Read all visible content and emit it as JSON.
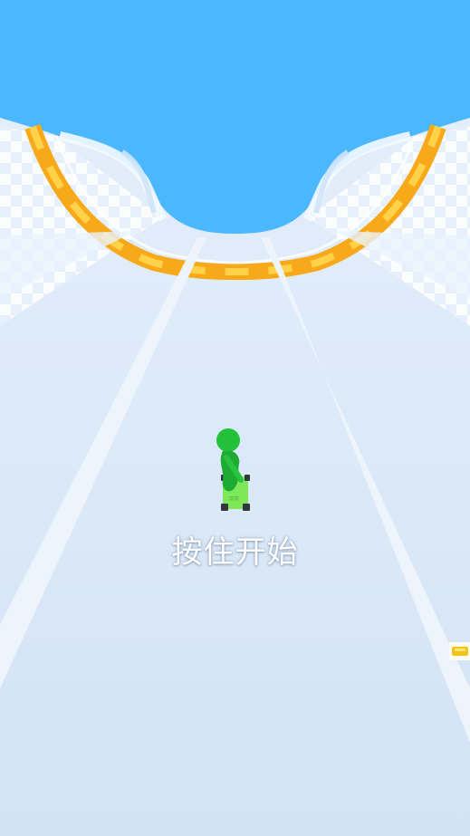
{
  "game": {
    "start_hint": "按住开始"
  },
  "player": {
    "character_color": "#22c13a",
    "board_color": "#7ee85a"
  },
  "colors": {
    "sky": "#4bb8fd",
    "track": "#d6e6f7",
    "track_edge_stripe": "#f0c020",
    "lane_lines": "#eef4fb"
  },
  "pickups": [
    {
      "name": "gold-bar-pickup",
      "icon": "gold-bar-icon"
    }
  ]
}
